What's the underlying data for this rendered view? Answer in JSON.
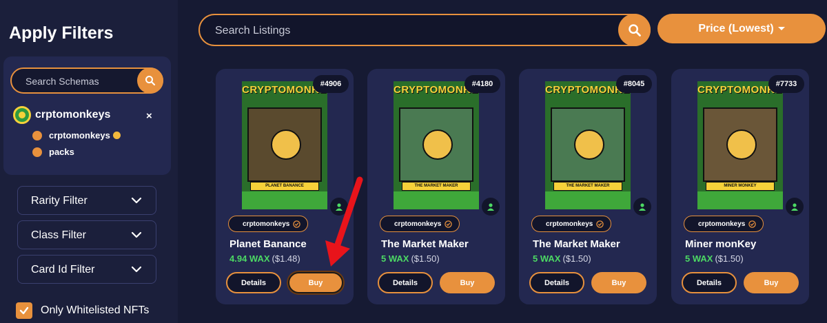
{
  "sidebar": {
    "title": "Apply Filters",
    "schema_search": {
      "placeholder": "Search Schemas"
    },
    "collection": {
      "name": "crptomonkeys",
      "close": "×"
    },
    "schemas": [
      {
        "label": "crptomonkeys"
      },
      {
        "label": "packs"
      }
    ],
    "filters": [
      {
        "label": "Rarity Filter"
      },
      {
        "label": "Class Filter"
      },
      {
        "label": "Card Id Filter"
      }
    ],
    "whitelist": {
      "label": "Only Whitelisted NFTs",
      "checked": true
    }
  },
  "topbar": {
    "search_placeholder": "Search Listings",
    "sort_label": "Price (Lowest)"
  },
  "cards": [
    {
      "mint": "#4906",
      "logo": "CRYPTOMONKEYS",
      "banner": "PLANET BANANCE",
      "collection": "crptomonkeys",
      "name": "Planet Banance",
      "price_wax": "4.94 WAX",
      "price_usd": "($1.48)",
      "details": "Details",
      "buy": "Buy"
    },
    {
      "mint": "#4180",
      "logo": "CRYPTOMONKEYS",
      "banner": "THE MARKET MAKER",
      "collection": "crptomonkeys",
      "name": "The Market Maker",
      "price_wax": "5 WAX",
      "price_usd": "($1.50)",
      "details": "Details",
      "buy": "Buy"
    },
    {
      "mint": "#8045",
      "logo": "CRYPTOMONKEYS",
      "banner": "THE MARKET MAKER",
      "collection": "crptomonkeys",
      "name": "The Market Maker",
      "price_wax": "5 WAX",
      "price_usd": "($1.50)",
      "details": "Details",
      "buy": "Buy"
    },
    {
      "mint": "#7733",
      "logo": "CRYPTOMONKEYS",
      "banner": "MINER MONKEY",
      "collection": "crptomonkeys",
      "name": "Miner monKey",
      "price_wax": "5 WAX",
      "price_usd": "($1.50)",
      "details": "Details",
      "buy": "Buy"
    }
  ],
  "colors": {
    "accent": "#e8913d",
    "price": "#4cd964",
    "background": "#161a33",
    "panel": "#232850"
  },
  "icons": [
    "search-icon",
    "close-icon",
    "chevron-down-icon",
    "checkmark-icon",
    "verified-icon",
    "user-icon",
    "coin-icon",
    "red-arrow-annotation"
  ]
}
